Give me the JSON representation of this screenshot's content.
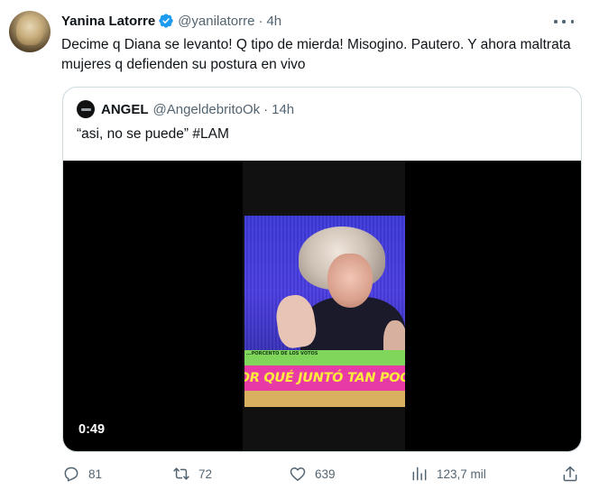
{
  "author": {
    "name": "Yanina Latorre",
    "handle": "@yanilatorre",
    "separator": "·",
    "time": "4h",
    "verified_color": "#1d9bf0"
  },
  "tweet": {
    "text": "Decime q Diana se levanto! Q tipo de mierda! Misogino. Pautero. Y ahora maltrata mujeres q defienden su postura en vivo"
  },
  "quoted": {
    "name": "ANGEL",
    "handle": "@AngeldebritoOk",
    "separator": "·",
    "time": "14h",
    "text": "“asi, no se puede” #LAM",
    "video": {
      "duration": "0:49",
      "caption_small": "...PORCENTO DE LOS VOTOS",
      "caption_big": "POR QUÉ JUNTÓ TAN POCO"
    }
  },
  "actions": {
    "replies": "81",
    "retweets": "72",
    "likes": "639",
    "views": "123,7 mil"
  },
  "icons": {
    "more": "more-icon",
    "reply": "reply-icon",
    "retweet": "retweet-icon",
    "like": "like-icon",
    "views": "views-icon",
    "share": "share-icon",
    "verified": "verified-badge-icon"
  },
  "colors": {
    "text_primary": "#0f1419",
    "text_secondary": "#536471",
    "border": "#cfd9de"
  }
}
